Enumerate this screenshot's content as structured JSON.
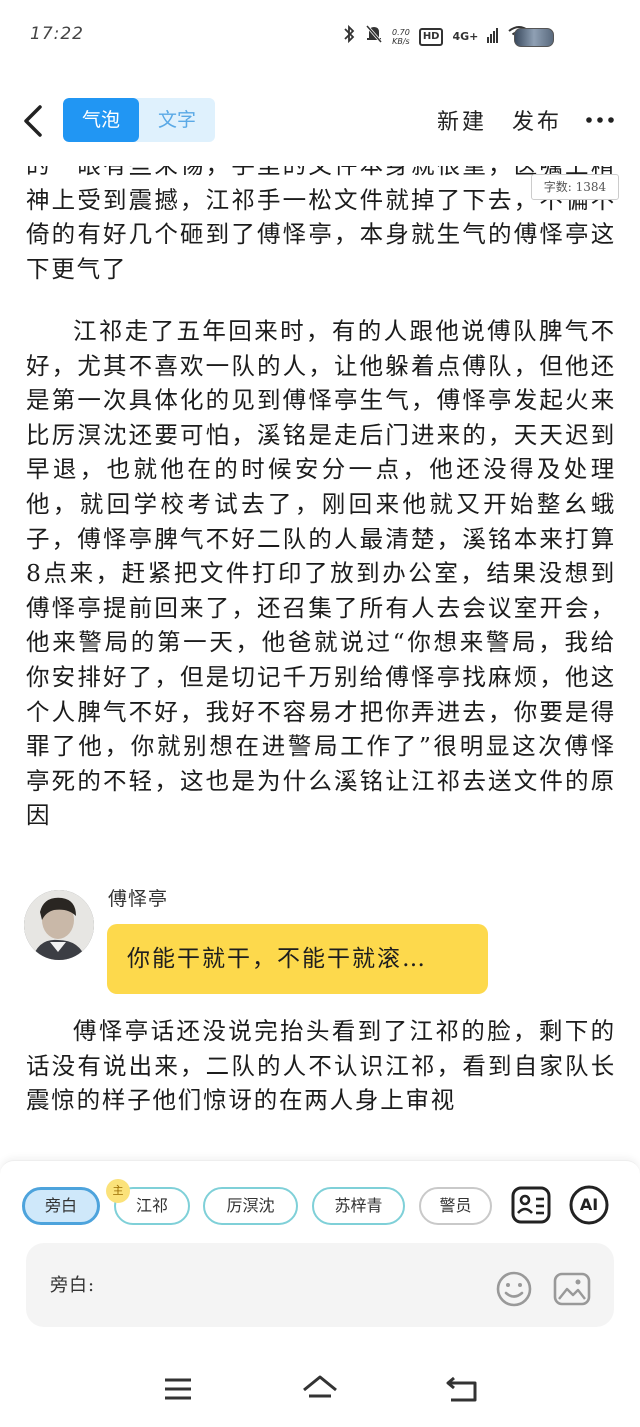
{
  "status_bar": {
    "time": "17:22",
    "speed_value": "0.70",
    "speed_unit": "KB/s",
    "hd": "HD",
    "network": "4G+"
  },
  "nav": {
    "tab_bubble": "气泡",
    "tab_text": "文字",
    "new_label": "新建",
    "publish_label": "发布"
  },
  "content": {
    "partial_top": "的一眼有些来惕，手里的文件本身就很重，医嘱上精神上受到震撼，江祁手一松文件就掉了下去，不偏不倚的有好几个砸到了傅怿亭，本身就生气的傅怿亭这下更气了",
    "paragraph_main": "江祁走了五年回来时，有的人跟他说傅队脾气不好，尤其不喜欢一队的人，让他躲着点傅队，但他还是第一次具体化的见到傅怿亭生气，傅怿亭发起火来比厉溟沈还要可怕，溪铭是走后门进来的，天天迟到早退，也就他在的时候安分一点，他还没得及处理他，就回学校考试去了，刚回来他就又开始整幺蛾子，傅怿亭脾气不好二队的人最清楚，溪铭本来打算8点来，赶紧把文件打印了放到办公室，结果没想到傅怿亭提前回来了，还召集了所有人去会议室开会，他来警局的第一天，他爸就说过“你想来警局，我给你安排好了，但是切记千万别给傅怿亭找麻烦，他这个人脾气不好，我好不容易才把你弄进去，你要是得罪了他，你就别想在进警局工作了”很明显这次傅怿亭死的不轻，这也是为什么溪铭让江祁去送文件的原因",
    "word_count": "字数: 1384",
    "dialogue": {
      "speaker": "傅怿亭",
      "text": "你能干就干，不能干就滚…"
    },
    "paragraph_tail": "傅怿亭话还没说完抬头看到了江祁的脸，剩下的话没有说出来，二队的人不认识江祁，看到自家队长震惊的样子他们惊讶的在两人身上审视"
  },
  "editor": {
    "chips": [
      "旁白",
      "江祁",
      "厉溟沈",
      "苏梓青",
      "警员"
    ],
    "lead_badge": "主",
    "ai_label": "AI",
    "input_label": "旁白:"
  },
  "colors": {
    "accent_blue": "#2196f3",
    "bubble_yellow": "#fdd94c",
    "chip_border": "#7fd0d8"
  }
}
